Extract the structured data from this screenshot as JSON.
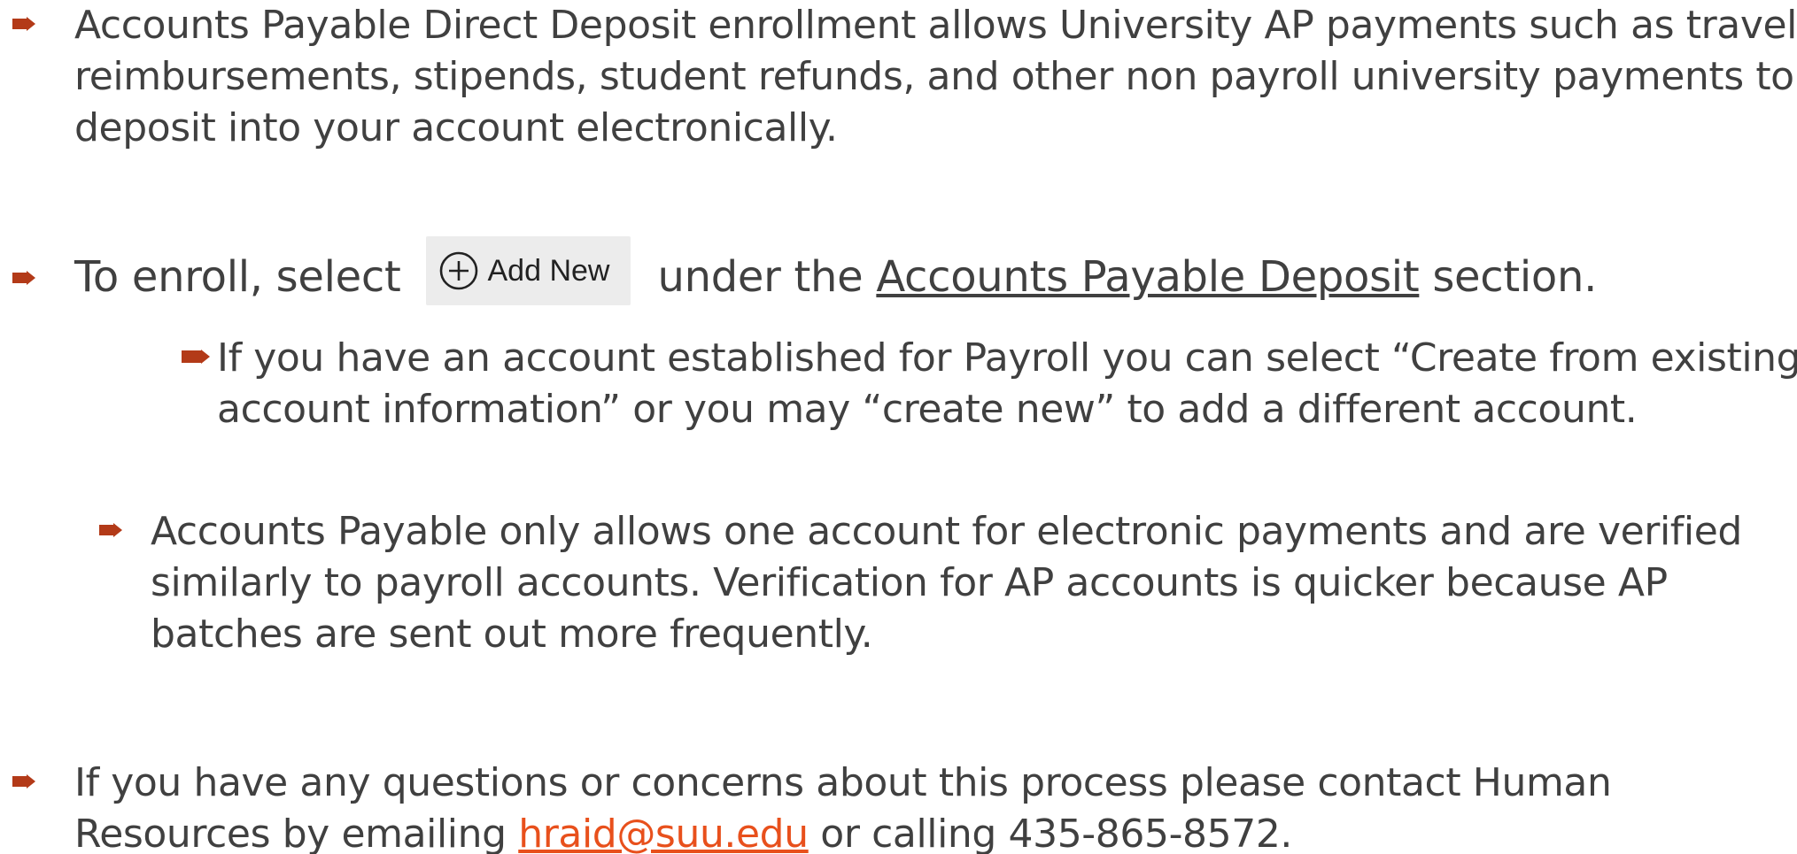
{
  "bullets": {
    "intro": "Accounts Payable Direct Deposit enrollment allows University AP payments such as travel reimbursements, stipends, student refunds, and other non payroll university payments to deposit into your account electronically.",
    "enroll": {
      "before": "To enroll, select",
      "button_label": "Add New",
      "after": "under the",
      "section_link": "Accounts Payable Deposit",
      "end": "section."
    },
    "existing_account": "If you have an account established for Payroll you can select “Create from existing account information” or you may “create new” to add a different account.",
    "one_account": "Accounts Payable only allows one account for electronic payments and are verified similarly to payroll accounts.  Verification for AP accounts is quicker because AP batches are sent out more frequently.",
    "contact": {
      "before": "If you have any questions or concerns about this process please contact Human Resources by emailing",
      "email": "hraid@suu.edu",
      "after": "or calling 435-865-8572."
    }
  },
  "colors": {
    "bullet": "#b33a18",
    "text": "#404040",
    "link": "#e8501c",
    "button_bg": "#ececec"
  },
  "icons": {
    "bullet": "arrow-bullet-icon",
    "button": "plus-circle-icon"
  }
}
